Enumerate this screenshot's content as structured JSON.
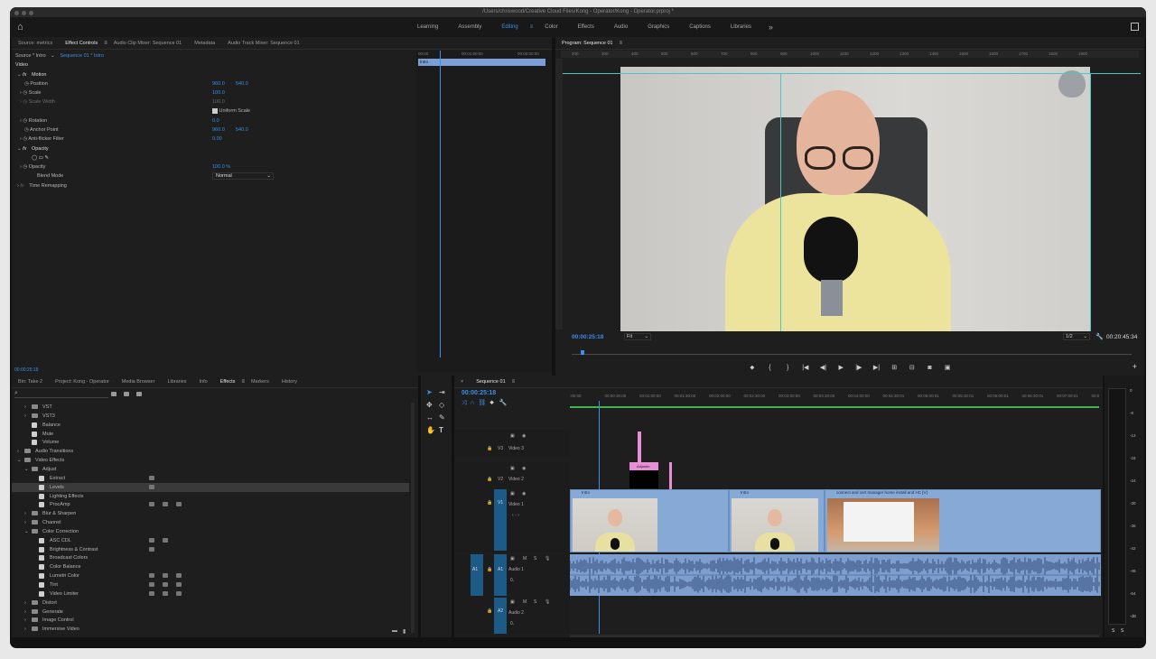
{
  "titlebar": {
    "title": "/Users/chriswood/Creative Cloud Files/Kong - Operator/Kong - Operator.prproj *"
  },
  "workspaces": {
    "items": [
      "Learning",
      "Assembly",
      "Editing",
      "Color",
      "Effects",
      "Audio",
      "Graphics",
      "Captions",
      "Libraries"
    ],
    "active": "Editing",
    "more": "»"
  },
  "effect_controls": {
    "tabs": [
      "Source: metrics",
      "Effect Controls",
      "Audio Clip Mixer: Sequence 01",
      "Metadata",
      "Audio Track Mixer: Sequence 01"
    ],
    "source_label": "Source * Intro",
    "sequence_label": "Sequence 01 * Intro",
    "video_header": "Video",
    "motion": "Motion",
    "position": {
      "label": "Position",
      "x": "960.0",
      "y": "540.0"
    },
    "scale": {
      "label": "Scale",
      "value": "100.0"
    },
    "scale_width": {
      "label": "Scale Width",
      "value": "100.0"
    },
    "uniform_scale": "Uniform Scale",
    "rotation": {
      "label": "Rotation",
      "value": "0.0"
    },
    "anchor_point": {
      "label": "Anchor Point",
      "x": "960.0",
      "y": "540.0"
    },
    "anti_flicker": {
      "label": "Anti-flicker Filter",
      "value": "0.00"
    },
    "opacity_header": "Opacity",
    "opacity": {
      "label": "Opacity",
      "value": "100.0 %"
    },
    "blend_mode": {
      "label": "Blend Mode",
      "value": "Normal"
    },
    "time_remap": "Time Remapping",
    "timeline_start": "00:00",
    "timeline_mid": "00:01:00:00",
    "timeline_end": "00:02:00:00",
    "clip_name": "Intro",
    "timecode": "00:00:25:18"
  },
  "program": {
    "title": "Program: Sequence 01",
    "ruler": [
      "200",
      "300",
      "400",
      "500",
      "600",
      "700",
      "800",
      "900",
      "1000",
      "1100",
      "1200",
      "1300",
      "1400",
      "1500",
      "1600",
      "1700",
      "1800",
      "1900"
    ],
    "timecode": "00:00:25:18",
    "fit": "Fit",
    "resolution": "1/2",
    "duration": "00:20:45:34"
  },
  "project": {
    "tabs": [
      "Bin: Take 2",
      "Project: Kong - Operator",
      "Media Browser",
      "Libraries",
      "Info",
      "Effects",
      "Markers",
      "History"
    ],
    "active_tab": "Effects",
    "tree": [
      {
        "label": "VST",
        "kind": "folder",
        "indent": 1,
        "icons": 0
      },
      {
        "label": "VST3",
        "kind": "folder",
        "indent": 1,
        "icons": 0
      },
      {
        "label": "Balance",
        "kind": "fx",
        "indent": 1,
        "icons": 0
      },
      {
        "label": "Mute",
        "kind": "fx",
        "indent": 1,
        "icons": 0
      },
      {
        "label": "Volume",
        "kind": "fx",
        "indent": 1,
        "icons": 0
      },
      {
        "label": "Audio Transitions",
        "kind": "folder",
        "indent": 0,
        "icons": 0
      },
      {
        "label": "Video Effects",
        "kind": "folder",
        "indent": 0,
        "icons": 0
      },
      {
        "label": "Adjust",
        "kind": "folder",
        "indent": 1,
        "icons": 0
      },
      {
        "label": "Extract",
        "kind": "fx",
        "indent": 2,
        "icons": 1
      },
      {
        "label": "Levels",
        "kind": "fx",
        "indent": 2,
        "icons": 1,
        "selected": true
      },
      {
        "label": "Lighting Effects",
        "kind": "fx",
        "indent": 2,
        "icons": 0
      },
      {
        "label": "ProcAmp",
        "kind": "fx",
        "indent": 2,
        "icons": 3
      },
      {
        "label": "Blur & Sharpen",
        "kind": "folder",
        "indent": 1,
        "icons": 0
      },
      {
        "label": "Channel",
        "kind": "folder",
        "indent": 1,
        "icons": 0
      },
      {
        "label": "Color Correction",
        "kind": "folder",
        "indent": 1,
        "icons": 0
      },
      {
        "label": "ASC CDL",
        "kind": "fx",
        "indent": 2,
        "icons": 2
      },
      {
        "label": "Brightness & Contrast",
        "kind": "fx",
        "indent": 2,
        "icons": 1
      },
      {
        "label": "Broadcast Colors",
        "kind": "fx",
        "indent": 2,
        "icons": 0
      },
      {
        "label": "Color Balance",
        "kind": "fx",
        "indent": 2,
        "icons": 0
      },
      {
        "label": "Lumetri Color",
        "kind": "fx",
        "indent": 2,
        "icons": 3
      },
      {
        "label": "Tint",
        "kind": "fx",
        "indent": 2,
        "icons": 3
      },
      {
        "label": "Video Limiter",
        "kind": "fx",
        "indent": 2,
        "icons": 3
      },
      {
        "label": "Distort",
        "kind": "folder",
        "indent": 1,
        "icons": 0
      },
      {
        "label": "Generate",
        "kind": "folder",
        "indent": 1,
        "icons": 0
      },
      {
        "label": "Image Control",
        "kind": "folder",
        "indent": 1,
        "icons": 0
      },
      {
        "label": "Immersive Video",
        "kind": "folder",
        "indent": 1,
        "icons": 0
      }
    ]
  },
  "timeline": {
    "title": "Sequence 01",
    "timecode": "00:00:25:18",
    "ruler": [
      ":00:00",
      "00:00:30:00",
      "00:01:00:00",
      "00:01:30:00",
      "00:02:00:00",
      "00:02:30:00",
      "00:03:00:00",
      "00:03:30:00",
      "00:04:00:00",
      "00:04:30:01",
      "00:05:00:01",
      "00:05:30:01",
      "00:06:00:01",
      "00:06:30:01",
      "00:07:00:01",
      "00:07:3"
    ],
    "tracks": {
      "v3": "V3",
      "v3_name": "Video 3",
      "v2": "V2",
      "v2_name": "Video 2",
      "v1": "V1",
      "v1_name": "Video 1",
      "a1": "A1",
      "a1_name": "Audio 1",
      "a2": "A2",
      "a2_name": "Audio 2",
      "a1_src": "A1",
      "m": "M",
      "s": "S",
      "vol": "0."
    },
    "clips": {
      "c1": "Intro",
      "c2": "Intro",
      "c3": "connect and cert manager home install and HC [V]",
      "adjust": "Adjustm"
    }
  },
  "meter": {
    "labels": [
      "0",
      "-6",
      "-12",
      "-18",
      "-24",
      "-30",
      "-36",
      "-42",
      "-48",
      "-54",
      "-dB"
    ],
    "s1": "S",
    "s2": "S"
  }
}
